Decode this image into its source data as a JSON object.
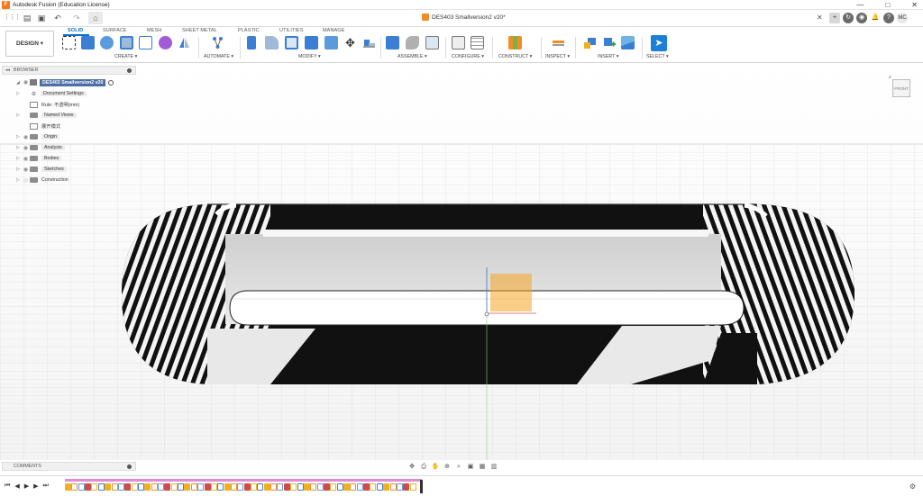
{
  "window": {
    "title": "Autodesk Fusion (Education License)",
    "logo_letter": "F",
    "minimize": "—",
    "maximize": "□",
    "close": "✕"
  },
  "quick_access": {
    "grid_icon": "⋮⋮⋮",
    "file_icon": "▤",
    "save_icon": "▣",
    "undo_icon": "↶",
    "redo_icon": "↷",
    "home_icon": "⌂",
    "document_title": "DES403 Smallversion2 v20*",
    "close_tab": "✕",
    "right_buttons": [
      "+",
      "↻",
      "◉",
      "🔔",
      "?"
    ],
    "user_initials": "MC"
  },
  "ribbon": {
    "workspace": "DESIGN ▾",
    "tabs": [
      "SOLID",
      "SURFACE",
      "MESH",
      "SHEET METAL",
      "PLASTIC",
      "UTILITIES",
      "MANAGE"
    ],
    "active_tab": "SOLID",
    "groups": [
      "CREATE ▾",
      "AUTOMATE ▾",
      "MODIFY ▾",
      "ASSEMBLE ▾",
      "CONFIGURE ▾",
      "CONSTRUCT ▾",
      "INSPECT ▾",
      "INSERT ▾",
      "SELECT ▾"
    ],
    "accent_color": "#0d6ec9"
  },
  "browser": {
    "title": "BROWSER",
    "collapse_icon": "◂◂",
    "root": "DES403 Smallversion2 v20",
    "items": [
      {
        "label": "Document Settings",
        "type": "settings"
      },
      {
        "label": "Rule: 不透明(mm)",
        "type": "rule"
      },
      {
        "label": "Named Views",
        "type": "folder"
      },
      {
        "label": "展开模式",
        "type": "rule"
      },
      {
        "label": "Origin",
        "type": "folder"
      },
      {
        "label": "Analysis",
        "type": "folder"
      },
      {
        "label": "Bodies",
        "type": "folder"
      },
      {
        "label": "Sketches",
        "type": "folder"
      },
      {
        "label": "Construction",
        "type": "folder"
      }
    ]
  },
  "viewcube": {
    "face": "FRONT",
    "axis": "Z"
  },
  "comments": {
    "title": "COMMENTS"
  },
  "navbar": {
    "icons": [
      "✥",
      "⎙",
      "✋",
      "⊕",
      "⌕",
      "▣",
      "▦",
      "▥"
    ]
  },
  "timeline": {
    "controls": [
      "⏮",
      "◀",
      "▶",
      "▶",
      "⏭"
    ],
    "settings_icon": "⚙",
    "feature_count": 53
  }
}
